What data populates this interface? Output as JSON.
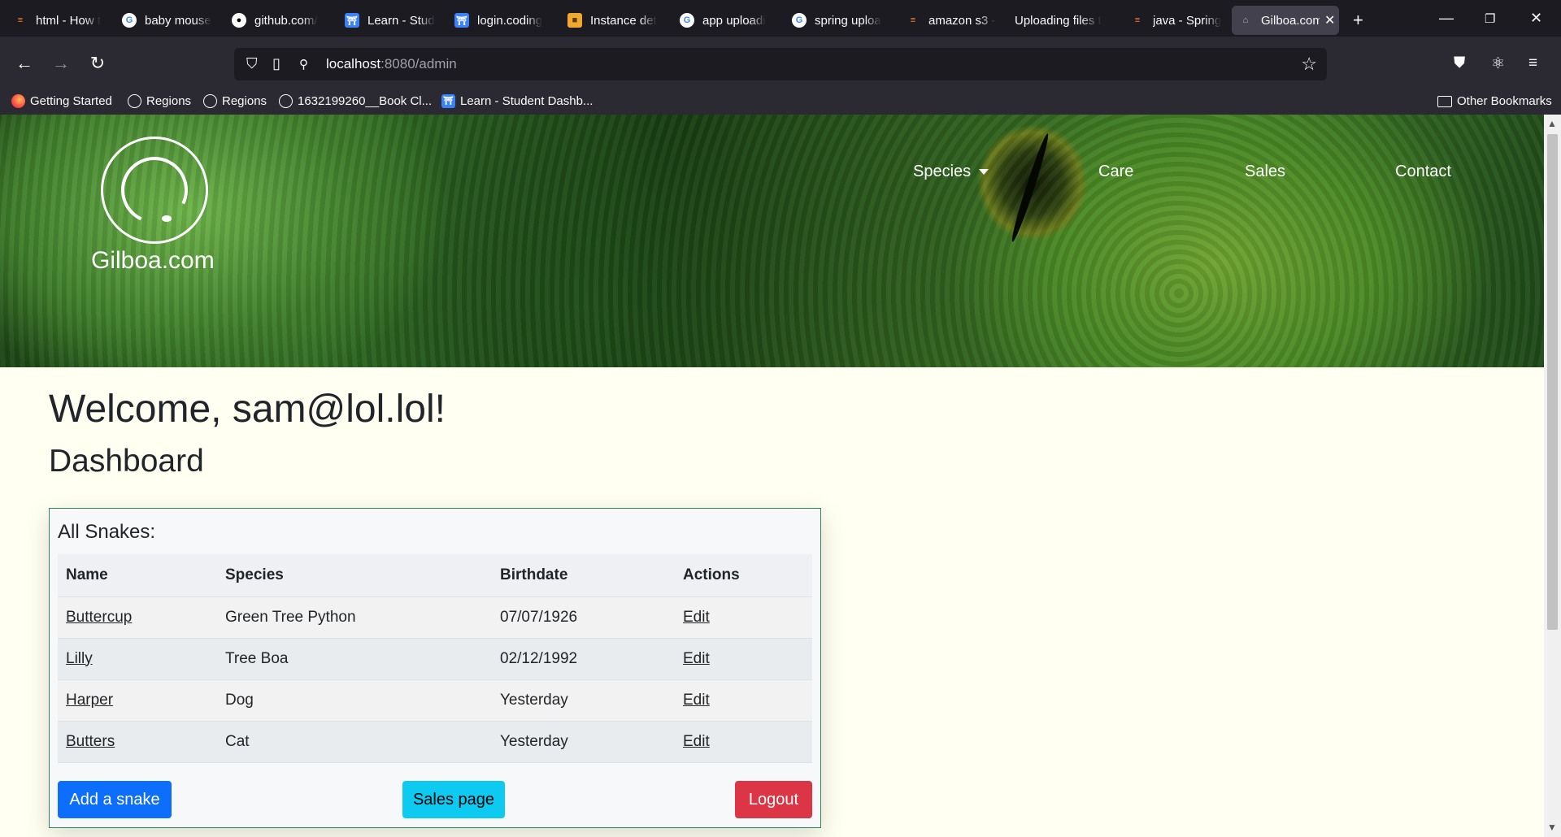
{
  "tabs": [
    {
      "label": "html - How t",
      "icon": "stackoverflow-icon"
    },
    {
      "label": "baby mouse",
      "icon": "google-icon"
    },
    {
      "label": "github.com/",
      "icon": "github-icon"
    },
    {
      "label": "Learn - Stud",
      "icon": "codingdojo-icon"
    },
    {
      "label": "login.coding",
      "icon": "codingdojo-icon"
    },
    {
      "label": "Instance det",
      "icon": "aws-icon"
    },
    {
      "label": "app uploadi",
      "icon": "google-icon"
    },
    {
      "label": "spring uploa",
      "icon": "google-icon"
    },
    {
      "label": "amazon s3 -",
      "icon": "stackoverflow-icon"
    },
    {
      "label": "Uploading files t",
      "icon": "none"
    },
    {
      "label": "java - Spring",
      "icon": "stackoverflow-icon"
    },
    {
      "label": "Gilboa.com",
      "icon": "gilboa-icon",
      "active": true
    }
  ],
  "address": {
    "host": "localhost",
    "path": ":8080/admin"
  },
  "bookmarks": [
    {
      "label": "Getting Started",
      "icon": "firefox-icon"
    },
    {
      "label": "Regions",
      "icon": "globe-icon"
    },
    {
      "label": "Regions",
      "icon": "globe-icon"
    },
    {
      "label": "1632199260__Book Cl...",
      "icon": "globe-icon"
    },
    {
      "label": "Learn - Student Dashb...",
      "icon": "codingdojo-icon"
    }
  ],
  "other_bookmarks": "Other Bookmarks",
  "site": {
    "brand": "Gilboa.com",
    "nav": {
      "species": "Species",
      "care": "Care",
      "sales": "Sales",
      "contact": "Contact"
    }
  },
  "welcome": "Welcome, sam@lol.lol!",
  "dashboard": "Dashboard",
  "card": {
    "title": "All Snakes:",
    "headers": [
      "Name",
      "Species",
      "Birthdate",
      "Actions"
    ],
    "rows": [
      {
        "name": "Buttercup",
        "species": "Green Tree Python",
        "birthdate": "07/07/1926",
        "action": "Edit"
      },
      {
        "name": "Lilly",
        "species": "Tree Boa",
        "birthdate": "02/12/1992",
        "action": "Edit"
      },
      {
        "name": "Harper",
        "species": "Dog",
        "birthdate": "Yesterday",
        "action": "Edit"
      },
      {
        "name": "Butters",
        "species": "Cat",
        "birthdate": "Yesterday",
        "action": "Edit"
      }
    ],
    "buttons": {
      "add": "Add a snake",
      "sales": "Sales page",
      "logout": "Logout"
    }
  },
  "colors": {
    "primary": "#0d6efd",
    "info": "#0dcaf0",
    "danger": "#dc3545",
    "card_border": "#2e8b57",
    "page_bg": "#fffff2"
  }
}
